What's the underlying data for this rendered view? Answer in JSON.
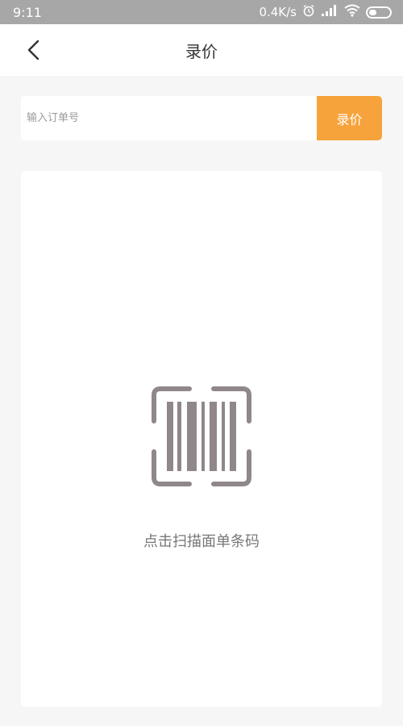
{
  "status_bar": {
    "time": "9:11",
    "network_speed": "0.4K/s",
    "icons": [
      "alarm-icon",
      "signal-icon",
      "wifi-icon",
      "battery-icon"
    ]
  },
  "header": {
    "title": "录价",
    "back_icon": "chevron-left-icon"
  },
  "order_entry": {
    "placeholder": "输入订单号",
    "value": "",
    "button_label": "录价"
  },
  "scan_area": {
    "icon": "barcode-scan-icon",
    "label": "点击扫描面单条码"
  },
  "colors": {
    "accent": "#f7a33b",
    "icon_gray": "#8f8789",
    "background": "#f6f6f6",
    "status_bar": "#a7a7a7"
  }
}
